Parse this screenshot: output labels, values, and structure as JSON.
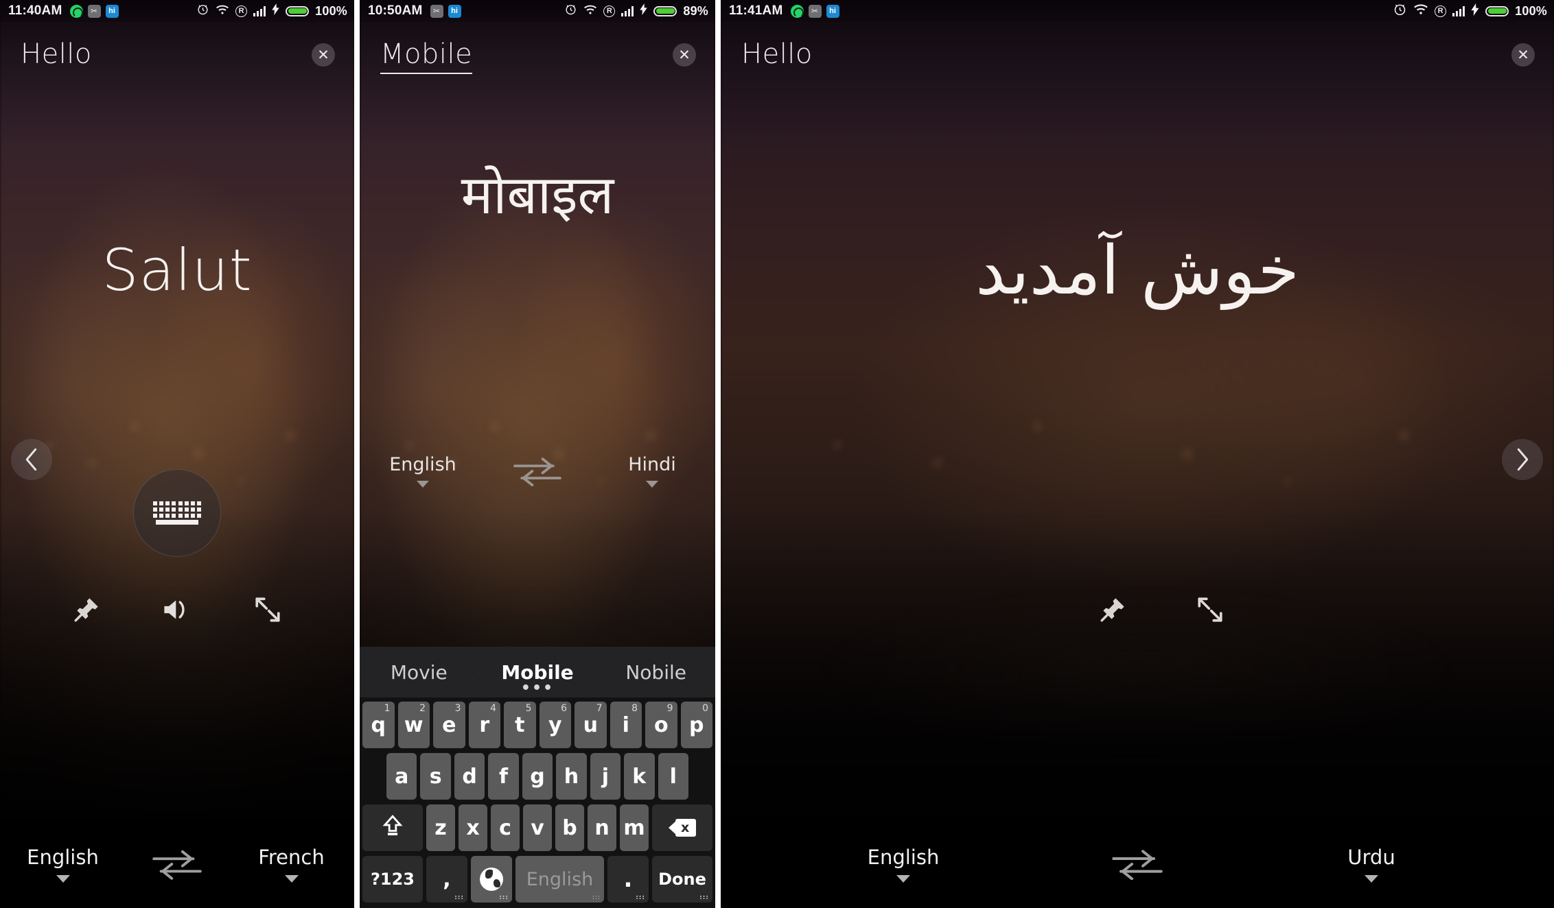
{
  "app": {
    "name": "Translator Keyboard"
  },
  "panels": [
    {
      "id": "panel-french",
      "statusbar": {
        "time": "11:40AM",
        "left_icons": [
          "whatsapp-icon",
          "scissors-app-icon",
          "hike-app-icon"
        ],
        "right_icons": [
          "alarm-icon",
          "wifi-icon",
          "roaming-icon",
          "signal-bars-icon",
          "charging-bolt-icon",
          "battery-icon"
        ],
        "battery_percent": "100%",
        "battery_color": "#4ccf34"
      },
      "header": {
        "word": "Hello",
        "underlined": false,
        "close_label": "✕"
      },
      "translation": "Salut",
      "nav": {
        "prev_visible": true,
        "next_visible": false
      },
      "actions": [
        "pin-icon",
        "speaker-icon",
        "expand-icon"
      ],
      "keyboard_button": "keyboard-icon",
      "language_bar": {
        "source": "English",
        "target": "French",
        "swap": "swap-arrows-icon"
      },
      "keyboard_open": false
    },
    {
      "id": "panel-hindi",
      "statusbar": {
        "time": "10:50AM",
        "left_icons": [
          "scissors-app-icon",
          "hike-app-icon"
        ],
        "right_icons": [
          "alarm-icon",
          "wifi-icon",
          "roaming-icon",
          "signal-bars-icon",
          "charging-bolt-icon",
          "battery-icon"
        ],
        "battery_percent": "89%",
        "battery_color": "#4ccf34"
      },
      "header": {
        "word": "Mobile",
        "underlined": true,
        "close_label": "✕"
      },
      "translation": "मोबाइल",
      "nav": {
        "prev_visible": false,
        "next_visible": false
      },
      "language_bar": {
        "source": "English",
        "target": "Hindi",
        "swap": "swap-arrows-icon"
      },
      "keyboard_open": true,
      "keyboard": {
        "suggestions": [
          {
            "label": "Movie",
            "selected": false
          },
          {
            "label": "Mobile",
            "selected": true
          },
          {
            "label": "Nobile",
            "selected": false
          }
        ],
        "suggestion_more": "•••",
        "row1": [
          {
            "key": "q",
            "hint": "1"
          },
          {
            "key": "w",
            "hint": "2"
          },
          {
            "key": "e",
            "hint": "3"
          },
          {
            "key": "r",
            "hint": "4"
          },
          {
            "key": "t",
            "hint": "5"
          },
          {
            "key": "y",
            "hint": "6"
          },
          {
            "key": "u",
            "hint": "7"
          },
          {
            "key": "i",
            "hint": "8"
          },
          {
            "key": "o",
            "hint": "9"
          },
          {
            "key": "p",
            "hint": "0"
          }
        ],
        "row2": [
          "a",
          "s",
          "d",
          "f",
          "g",
          "h",
          "j",
          "k",
          "l"
        ],
        "row3": {
          "shift": "shift-icon",
          "keys": [
            "z",
            "x",
            "c",
            "v",
            "b",
            "n",
            "m"
          ],
          "delete": "backspace-icon"
        },
        "row4": {
          "symbols": "?123",
          "comma": ",",
          "globe": "globe-icon",
          "space_label": "English",
          "period": ".",
          "enter": "Done"
        }
      }
    },
    {
      "id": "panel-urdu",
      "statusbar": {
        "time": "11:41AM",
        "left_icons": [
          "whatsapp-icon",
          "scissors-app-icon",
          "hike-app-icon"
        ],
        "right_icons": [
          "alarm-icon",
          "wifi-icon",
          "roaming-icon",
          "signal-bars-icon",
          "charging-bolt-icon",
          "battery-icon"
        ],
        "battery_percent": "100%",
        "battery_color": "#4ccf34"
      },
      "header": {
        "word": "Hello",
        "underlined": false,
        "close_label": "✕"
      },
      "translation": "خوش آمدید",
      "nav": {
        "prev_visible": false,
        "next_visible": true
      },
      "actions": [
        "pin-icon",
        "expand-icon"
      ],
      "keyboard_button": "keyboard-icon",
      "language_bar": {
        "source": "English",
        "target": "Urdu",
        "swap": "swap-arrows-icon"
      },
      "keyboard_open": false
    }
  ],
  "colors": {
    "battery_green": "#4ccf34",
    "key_light": "#5b5b5b",
    "key_dark": "#2b2b2b",
    "suggest_bg": "#232326",
    "text_primary": "#f6f2f0",
    "panel_divider": "#ffffff"
  }
}
